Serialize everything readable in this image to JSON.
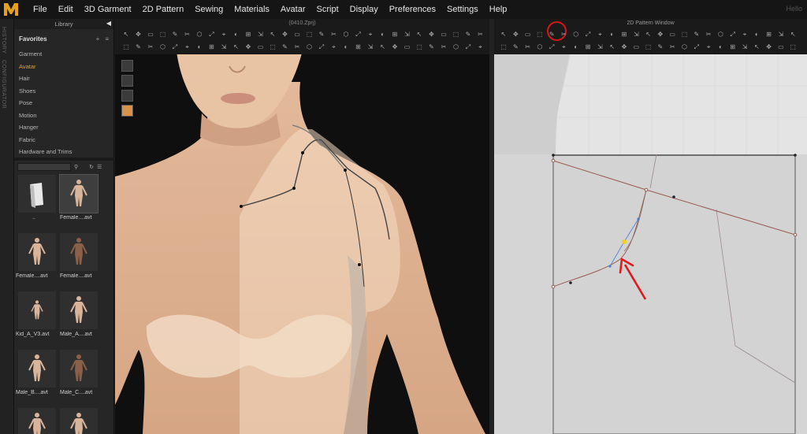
{
  "menubar": {
    "logo": "M",
    "menus": [
      "File",
      "Edit",
      "3D Garment",
      "2D Pattern",
      "Sewing",
      "Materials",
      "Avatar",
      "Script",
      "Display",
      "Preferences",
      "Settings",
      "Help"
    ],
    "user": "Hello"
  },
  "sidetabs": [
    "HISTORY",
    "CONFIGURATOR"
  ],
  "library": {
    "title": "Library",
    "favorites": "Favorites",
    "add": "+",
    "options": "≡",
    "categories": [
      {
        "label": "Garment",
        "active": false
      },
      {
        "label": "Avatar",
        "active": true
      },
      {
        "label": "Hair",
        "active": false
      },
      {
        "label": "Shoes",
        "active": false
      },
      {
        "label": "Pose",
        "active": false
      },
      {
        "label": "Motion",
        "active": false
      },
      {
        "label": "Hanger",
        "active": false
      },
      {
        "label": "Fabric",
        "active": false
      },
      {
        "label": "Hardware and Trims",
        "active": false
      }
    ],
    "items": [
      {
        "label": "..",
        "kind": "folder"
      },
      {
        "label": "Female....avt",
        "kind": "female",
        "selected": true
      },
      {
        "label": "Female....avt",
        "kind": "female"
      },
      {
        "label": "Female....avt",
        "kind": "female-dark"
      },
      {
        "label": "Kid_A_V3.avt",
        "kind": "kid"
      },
      {
        "label": "Male_A....avt",
        "kind": "male"
      },
      {
        "label": "Male_B....avt",
        "kind": "male"
      },
      {
        "label": "Male_C....avt",
        "kind": "male-dark"
      },
      {
        "label": "",
        "kind": "female"
      },
      {
        "label": "",
        "kind": "female"
      }
    ]
  },
  "view3d": {
    "title": "(0410.Zprj)"
  },
  "view2d": {
    "title": "2D Pattern Window"
  },
  "colors": {
    "accent": "#e6a020",
    "highlight": "#d01818",
    "arrow": "#e01a1a",
    "pattern_line": "#9a5a50",
    "curve_handle": "#4a7cd8",
    "selected_point": "#f0d020"
  }
}
